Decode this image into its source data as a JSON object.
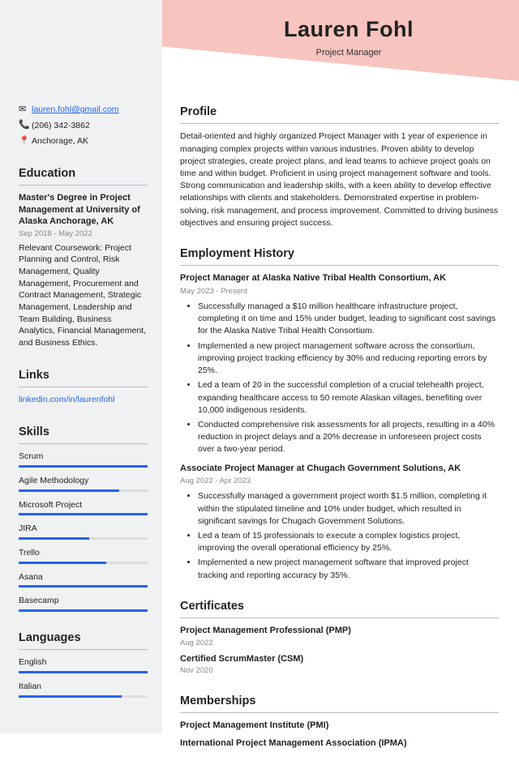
{
  "header": {
    "name": "Lauren Fohl",
    "title": "Project Manager"
  },
  "contact": {
    "email": "lauren.fohl@gmail.com",
    "phone": "(206) 342-3862",
    "location": "Anchorage, AK"
  },
  "sections": {
    "education": "Education",
    "links": "Links",
    "skills": "Skills",
    "languages": "Languages",
    "profile": "Profile",
    "employment": "Employment History",
    "certificates": "Certificates",
    "memberships": "Memberships"
  },
  "education": {
    "degree": "Master's Degree in Project Management at University of Alaska Anchorage, AK",
    "dates": "Sep 2018 - May 2022",
    "text": "Relevant Coursework: Project Planning and Control, Risk Management, Quality Management, Procurement and Contract Management, Strategic Management, Leadership and Team Building, Business Analytics, Financial Management, and Business Ethics."
  },
  "links": {
    "linkedin": "linkedin.com/in/laurenfohl"
  },
  "skills": [
    {
      "name": "Scrum",
      "level": 100
    },
    {
      "name": "Agile Methodology",
      "level": 78
    },
    {
      "name": "Microsoft Project",
      "level": 100
    },
    {
      "name": "JIRA",
      "level": 55
    },
    {
      "name": "Trello",
      "level": 68
    },
    {
      "name": "Asana",
      "level": 100
    },
    {
      "name": "Basecamp",
      "level": 100
    }
  ],
  "languages": [
    {
      "name": "English",
      "level": 100
    },
    {
      "name": "Italian",
      "level": 80
    }
  ],
  "profile": "Detail-oriented and highly organized Project Manager with 1 year of experience in managing complex projects within various industries. Proven ability to develop project strategies, create project plans, and lead teams to achieve project goals on time and within budget. Proficient in using project management software and tools. Strong communication and leadership skills, with a keen ability to develop effective relationships with clients and stakeholders. Demonstrated expertise in problem-solving, risk management, and process improvement. Committed to driving business objectives and ensuring project success.",
  "jobs": [
    {
      "title": "Project Manager at Alaska Native Tribal Health Consortium, AK",
      "dates": "May 2023 - Present",
      "bullets": [
        "Successfully managed a $10 million healthcare infrastructure project, completing it on time and 15% under budget, leading to significant cost savings for the Alaska Native Tribal Health Consortium.",
        "Implemented a new project management software across the consortium, improving project tracking efficiency by 30% and reducing reporting errors by 25%.",
        "Led a team of 20 in the successful completion of a crucial telehealth project, expanding healthcare access to 50 remote Alaskan villages, benefiting over 10,000 indigenous residents.",
        "Conducted comprehensive risk assessments for all projects, resulting in a 40% reduction in project delays and a 20% decrease in unforeseen project costs over a two-year period."
      ]
    },
    {
      "title": "Associate Project Manager at Chugach Government Solutions, AK",
      "dates": "Aug 2022 - Apr 2023",
      "bullets": [
        "Successfully managed a government project worth $1.5 million, completing it within the stipulated timeline and 10% under budget, which resulted in significant savings for Chugach Government Solutions.",
        "Led a team of 15 professionals to execute a complex logistics project, improving the overall operational efficiency by 25%.",
        "Implemented a new project management software that improved project tracking and reporting accuracy by 35%."
      ]
    }
  ],
  "certificates": [
    {
      "title": "Project Management Professional (PMP)",
      "date": "Aug 2022"
    },
    {
      "title": "Certified ScrumMaster (CSM)",
      "date": "Nov 2020"
    }
  ],
  "memberships": [
    "Project Management Institute (PMI)",
    "International Project Management Association (IPMA)"
  ]
}
